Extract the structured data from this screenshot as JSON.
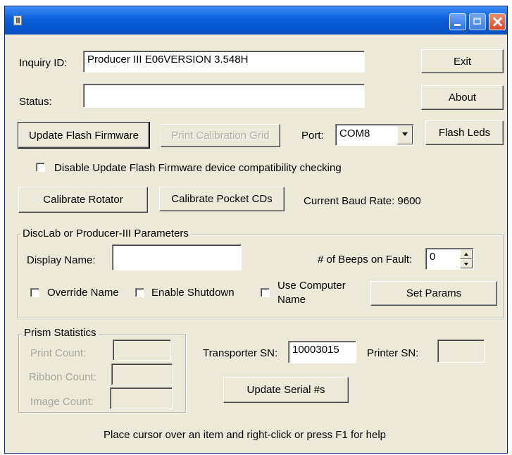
{
  "window": {
    "title": ""
  },
  "titlebar": {
    "icons": [
      "app-icon",
      "minimize-icon",
      "maximize-icon",
      "close-icon"
    ]
  },
  "inquiry": {
    "label": "Inquiry ID:",
    "value": "Producer III E06VERSION 3.548H"
  },
  "status": {
    "label": "Status:",
    "value": ""
  },
  "buttons": {
    "exit": "Exit",
    "about": "About",
    "update_flash": "Update Flash Firmware",
    "print_calibration": "Print Calibration Grid",
    "flash_leds": "Flash Leds",
    "calibrate_rotator": "Calibrate Rotator",
    "calibrate_pocket": "Calibrate Pocket CDs",
    "set_params": "Set Params",
    "update_serial": "Update Serial #s"
  },
  "port": {
    "label": "Port:",
    "selected": "COM8"
  },
  "disable_check": {
    "label": "Disable Update Flash Firmware device compatibility checking",
    "checked": false
  },
  "baud": {
    "text": "Current Baud Rate: 9600"
  },
  "params": {
    "title": "DiscLab or Producer-III Parameters",
    "display_name_label": "Display Name:",
    "display_name_value": "",
    "beeps_label": "# of Beeps on Fault:",
    "beeps_value": "0",
    "override_name": "Override Name",
    "enable_shutdown": "Enable Shutdown",
    "use_computer_name_1": "Use Computer",
    "use_computer_name_2": "Name"
  },
  "prism": {
    "title": "Prism Statistics",
    "print_count": "Print Count:",
    "ribbon_count": "Ribbon Count:",
    "image_count": "Image Count:"
  },
  "serials": {
    "transporter_label": "Transporter SN:",
    "transporter_value": "10003015",
    "printer_label": "Printer SN:",
    "printer_value": ""
  },
  "footer": {
    "help": "Place cursor over an item and right-click or press F1 for help"
  },
  "colors": {
    "titlebar": "#0a5fd8",
    "face": "#ece9d8"
  }
}
